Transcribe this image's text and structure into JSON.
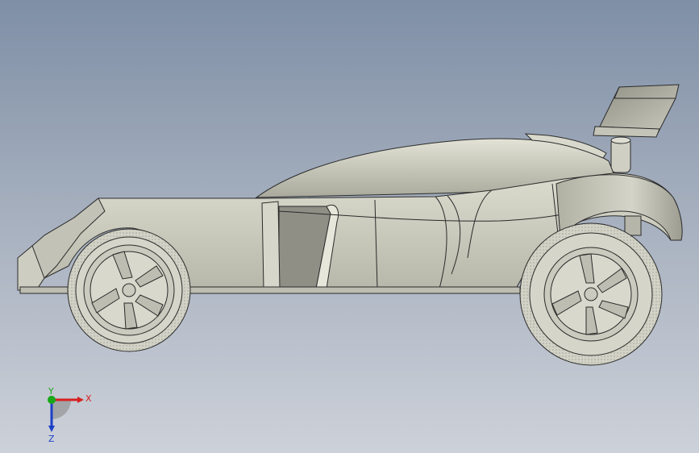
{
  "viewport": {
    "background_top": "#7f8fa6",
    "background_bottom": "#cdd1d9"
  },
  "model": {
    "body_color": "#c8c8bb",
    "shade_color": "#a5a598",
    "dark_color": "#7a7a70",
    "edge_color": "#2b2b2b",
    "tire_color": "#d0d0c4"
  },
  "triad": {
    "x_label": "X",
    "y_label": "Y",
    "z_label": "Z",
    "x_color": "#d62020",
    "y_color": "#18a818",
    "z_color": "#1c3fc8"
  }
}
